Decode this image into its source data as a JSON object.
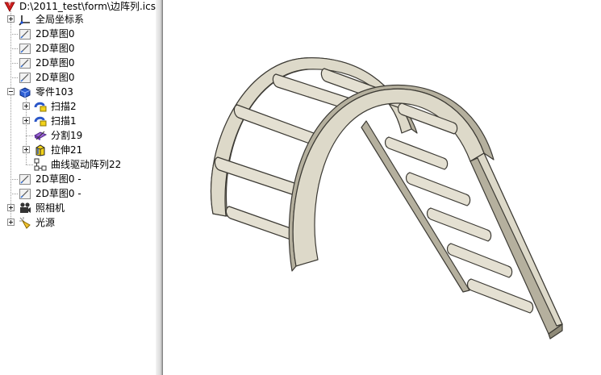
{
  "tree": {
    "root_label": "D:\\2011_test\\form\\边阵列.ics",
    "items": [
      {
        "label": "全局坐标系",
        "icon": "coordinate-system-icon"
      },
      {
        "label": "2D草图0",
        "icon": "sketch-icon"
      },
      {
        "label": "2D草图0",
        "icon": "sketch-icon"
      },
      {
        "label": "2D草图0",
        "icon": "sketch-icon"
      },
      {
        "label": "2D草图0",
        "icon": "sketch-icon"
      },
      {
        "label": "零件103",
        "icon": "part-icon"
      },
      {
        "label": "扫描2",
        "icon": "sweep-icon"
      },
      {
        "label": "扫描1",
        "icon": "sweep-icon"
      },
      {
        "label": "分割19",
        "icon": "split-icon"
      },
      {
        "label": "拉伸21",
        "icon": "extrude-icon"
      },
      {
        "label": "曲线驱动阵列22",
        "icon": "curve-pattern-icon"
      },
      {
        "label": "2D草图0 -",
        "icon": "sketch-icon"
      },
      {
        "label": "2D草图0 -",
        "icon": "sketch-icon"
      },
      {
        "label": "照相机",
        "icon": "camera-icon"
      },
      {
        "label": "光源",
        "icon": "light-icon"
      }
    ]
  },
  "colors": {
    "model_face": "#ddd9c9",
    "model_side": "#b5b09e",
    "model_edge": "#3c3a34",
    "rung": "#e4e0d2"
  }
}
